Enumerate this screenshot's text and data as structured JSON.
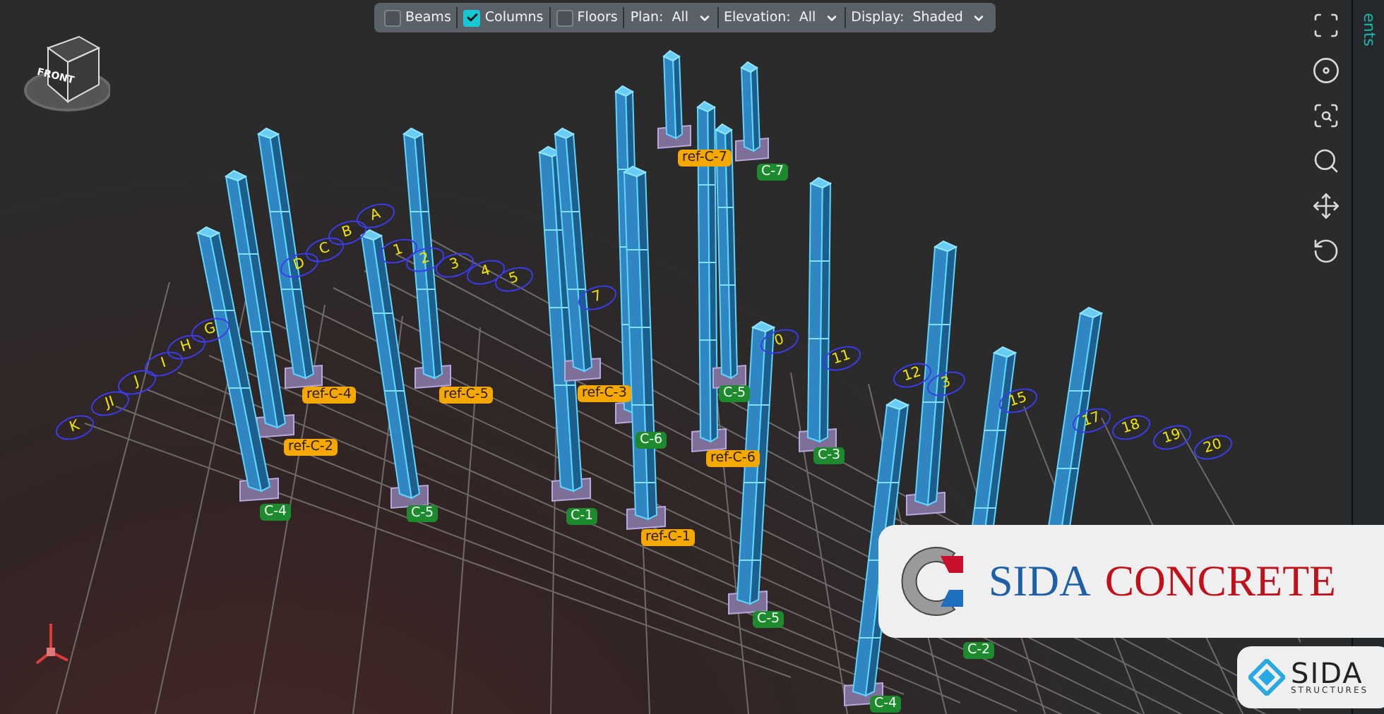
{
  "toolbar": {
    "filters": [
      {
        "label": "Beams",
        "checked": false
      },
      {
        "label": "Columns",
        "checked": true
      },
      {
        "label": "Floors",
        "checked": false
      }
    ],
    "dropdowns": [
      {
        "label": "Plan:",
        "value": "All"
      },
      {
        "label": "Elevation:",
        "value": "All"
      },
      {
        "label": "Display:",
        "value": "Shaded"
      }
    ]
  },
  "side_panel": {
    "title": "ents"
  },
  "view_cube": {
    "face": "FRONT"
  },
  "grid_bubbles": [
    "A",
    "B",
    "C",
    "D",
    "G",
    "H",
    "I",
    "J",
    "JI",
    "K",
    "1",
    "2",
    "3",
    "4",
    "5",
    "7",
    "0",
    "11",
    "12",
    "3",
    "15",
    "17",
    "18",
    "19",
    "20"
  ],
  "column_tags": [
    {
      "text": "ref-C-7",
      "color": "#f5a800"
    },
    {
      "text": "C-7",
      "color": "#1e8a2e"
    },
    {
      "text": "ref-C-4",
      "color": "#f5a800"
    },
    {
      "text": "ref-C-5",
      "color": "#f5a800"
    },
    {
      "text": "ref-C-3",
      "color": "#f5a800"
    },
    {
      "text": "C-5",
      "color": "#1e8a2e"
    },
    {
      "text": "ref-C-2",
      "color": "#f5a800"
    },
    {
      "text": "C-6",
      "color": "#1e8a2e"
    },
    {
      "text": "ref-C-6",
      "color": "#f5a800"
    },
    {
      "text": "C-3",
      "color": "#1e8a2e"
    },
    {
      "text": "C-4",
      "color": "#1e8a2e"
    },
    {
      "text": "C-5",
      "color": "#1e8a2e"
    },
    {
      "text": "C-1",
      "color": "#1e8a2e"
    },
    {
      "text": "ref-C-1",
      "color": "#f5a800"
    },
    {
      "text": "C-5",
      "color": "#1e8a2e"
    },
    {
      "text": "C-2",
      "color": "#1e8a2e"
    },
    {
      "text": "C-4",
      "color": "#1e8a2e"
    }
  ],
  "logo": {
    "brand": "SIDA",
    "product": "CONCRETE"
  },
  "badge": {
    "brand": "SIDA",
    "tagline": "STRUCTURES"
  }
}
